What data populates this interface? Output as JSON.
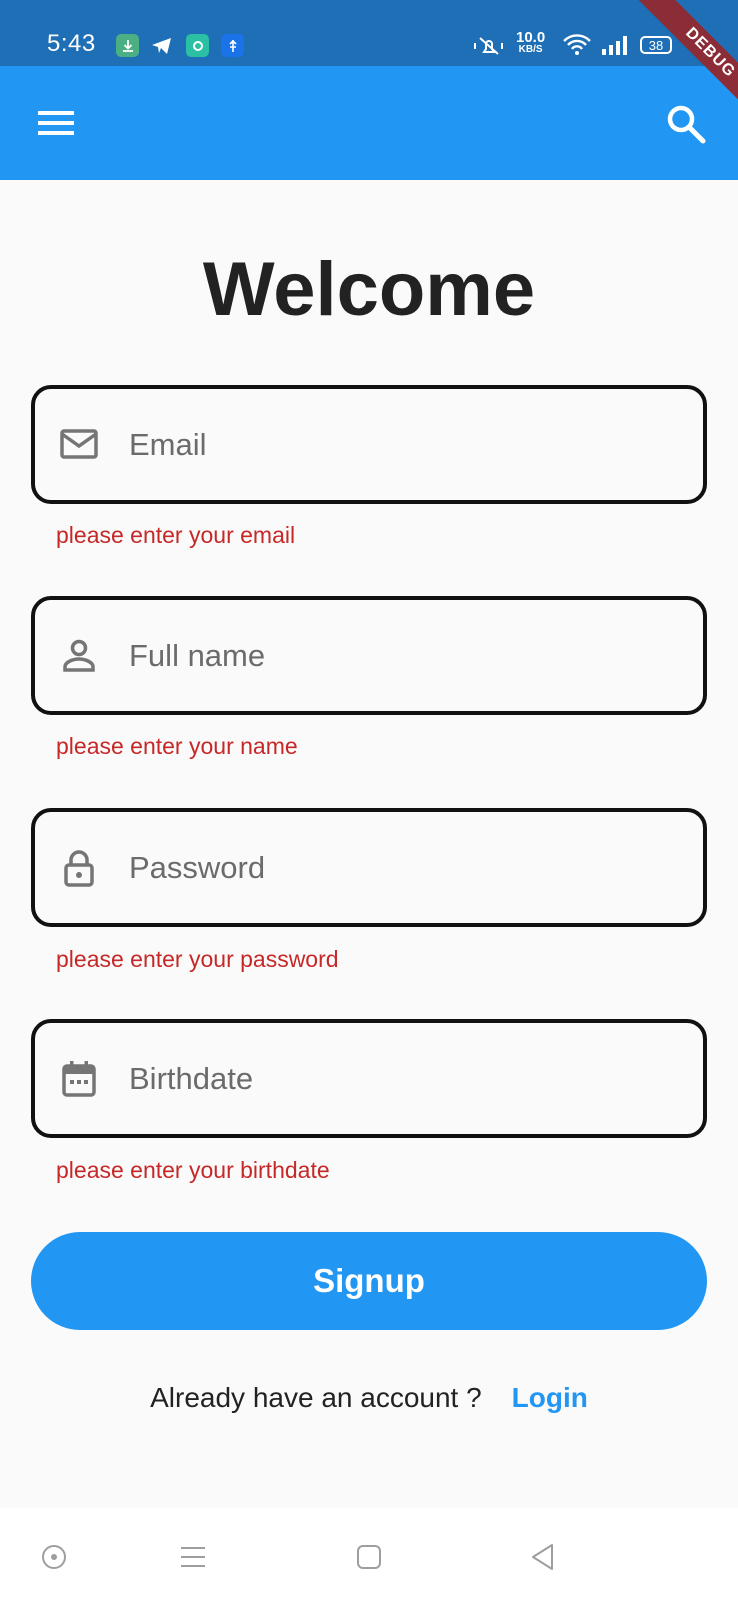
{
  "status_bar": {
    "time": "5:43",
    "speed_value": "10.0",
    "speed_unit": "KB/S",
    "battery": "38",
    "debug_banner": "DEBUG"
  },
  "app_bar": {
    "menu_icon": "hamburger-menu-icon",
    "search_icon": "search-icon",
    "color": "#2196f3"
  },
  "title": "Welcome",
  "fields": [
    {
      "placeholder": "Email",
      "icon": "mail-icon",
      "error": "please enter your email"
    },
    {
      "placeholder": "Full name",
      "icon": "person-icon",
      "error": "please enter your name"
    },
    {
      "placeholder": "Password",
      "icon": "lock-icon",
      "error": "please enter your password"
    },
    {
      "placeholder": "Birthdate",
      "icon": "calendar-icon",
      "error": "please enter your birthdate"
    }
  ],
  "signup_button": "Signup",
  "footer": {
    "prompt": "Already have an account ?",
    "login_link": "Login"
  },
  "colors": {
    "primary": "#2196f3",
    "error": "#c62828",
    "status_bar": "#1e6fb5"
  }
}
